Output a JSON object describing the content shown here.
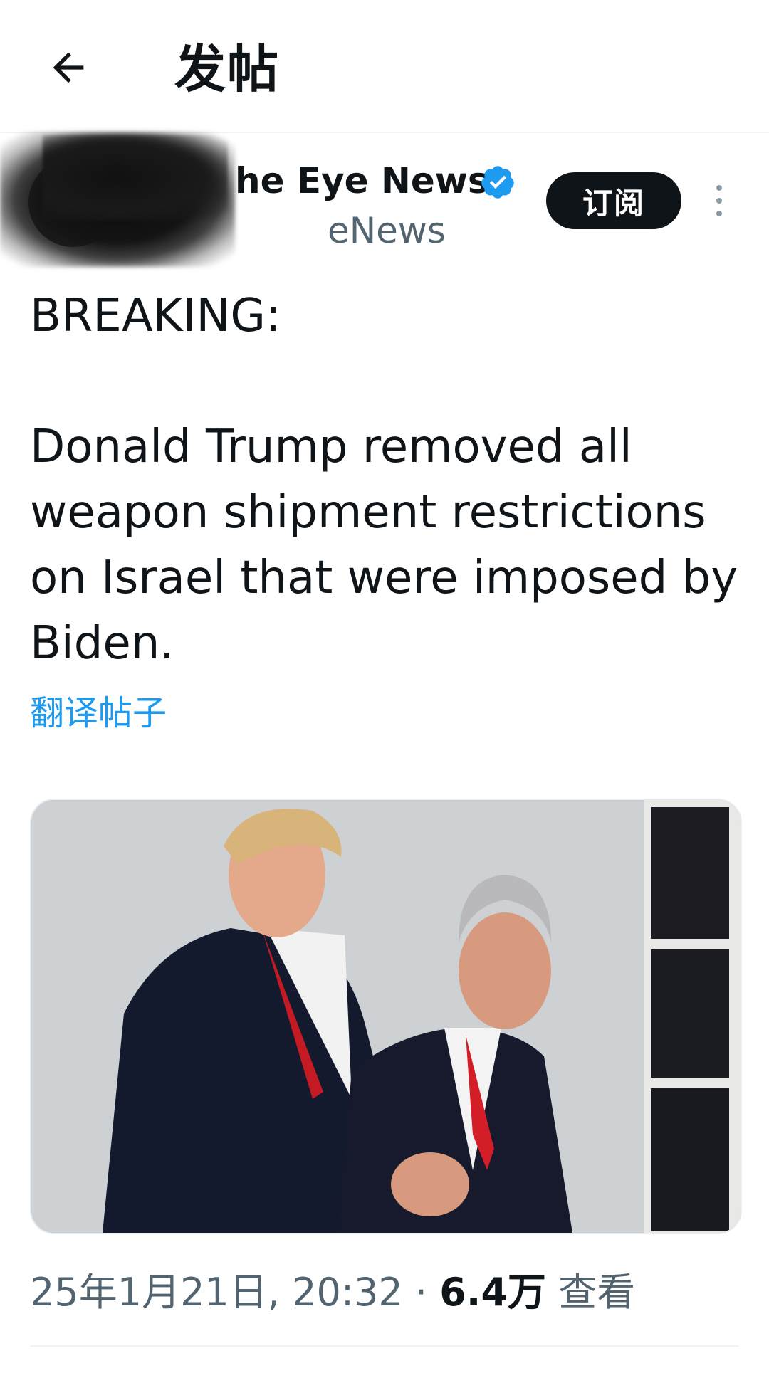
{
  "header": {
    "title": "发帖",
    "back_icon": "arrow-left-icon"
  },
  "author": {
    "display_name": "he Eye News",
    "handle": "eNews",
    "verified_icon": "verified-badge-icon",
    "verified_color": "#1d9bf0",
    "subscribe_label": "订阅",
    "more_icon": "more-vertical-icon"
  },
  "tweet": {
    "text": "BREAKING:\n\nDonald Trump removed all weapon shipment restrictions on Israel that were imposed by Biden.",
    "translate_label": "翻译帖子"
  },
  "media": {
    "type": "photo"
  },
  "meta": {
    "date": "25年1月21日, 20:32",
    "separator": "·",
    "views_count": "6.4万",
    "views_label": "查看"
  }
}
